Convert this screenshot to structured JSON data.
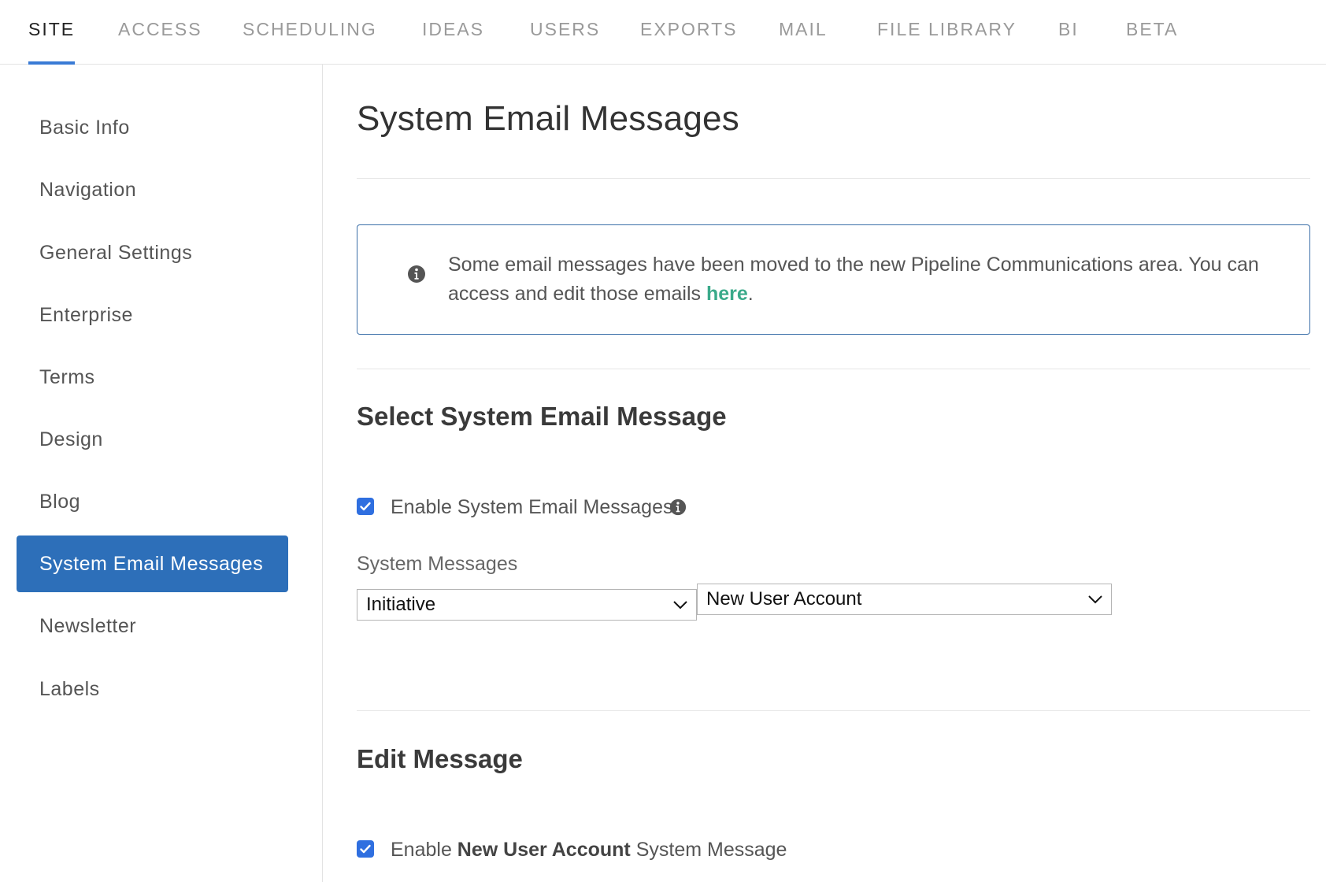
{
  "topnav": {
    "tabs": [
      {
        "label": "SITE",
        "active": true
      },
      {
        "label": "ACCESS"
      },
      {
        "label": "SCHEDULING"
      },
      {
        "label": "IDEAS"
      },
      {
        "label": "USERS"
      },
      {
        "label": "EXPORTS"
      },
      {
        "label": "MAIL"
      },
      {
        "label": "FILE LIBRARY"
      },
      {
        "label": "BI"
      },
      {
        "label": "BETA"
      }
    ]
  },
  "sidebar": {
    "items": [
      {
        "label": "Basic Info"
      },
      {
        "label": "Navigation"
      },
      {
        "label": "General Settings"
      },
      {
        "label": "Enterprise"
      },
      {
        "label": "Terms"
      },
      {
        "label": "Design"
      },
      {
        "label": "Blog"
      },
      {
        "label": "System Email Messages",
        "active": true
      },
      {
        "label": "Newsletter"
      },
      {
        "label": "Labels"
      }
    ]
  },
  "main": {
    "title": "System Email Messages",
    "notice": {
      "text": "Some email messages have been moved to the new Pipeline Communications area. You can access and edit those emails ",
      "link": "here",
      "suffix": "."
    },
    "select_section": {
      "title": "Select System Email Message",
      "enable_label": "Enable System Email Messages",
      "enable_checked": true,
      "field_label": "System Messages",
      "category_select": "Initiative",
      "message_select": "New User Account"
    },
    "edit_section": {
      "title": "Edit Message",
      "enable_prefix": "Enable ",
      "enable_bold": "New User Account",
      "enable_suffix": " System Message",
      "enable_checked": true
    }
  },
  "colors": {
    "accent": "#2d6fb9",
    "tab_underline": "#3a7bd5",
    "link": "#3aaa8a",
    "checkbox": "#2f6fe0"
  }
}
